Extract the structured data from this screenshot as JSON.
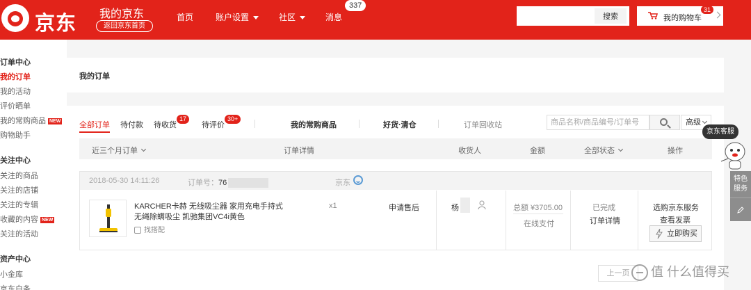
{
  "header": {
    "logo_text": "京东",
    "site_title": "我的京东",
    "home_link": "返回京东首页",
    "nav": [
      {
        "label": "首页"
      },
      {
        "label": "账户设置"
      },
      {
        "label": "社区"
      },
      {
        "label": "消息"
      }
    ],
    "message_count": "337",
    "search_value": "",
    "search_button": "搜索",
    "cart_label": "我的购物车",
    "cart_count": "31"
  },
  "sidebar": {
    "groups": [
      {
        "title": "订单中心",
        "items": [
          {
            "label": "我的订单",
            "active": true
          },
          {
            "label": "我的活动"
          },
          {
            "label": "评价晒单"
          },
          {
            "label": "我的常购商品",
            "badge": "NEW"
          },
          {
            "label": "购物助手"
          }
        ]
      },
      {
        "title": "关注中心",
        "items": [
          {
            "label": "关注的商品"
          },
          {
            "label": "关注的店铺"
          },
          {
            "label": "关注的专辑"
          },
          {
            "label": "收藏的内容",
            "badge": "NEW"
          },
          {
            "label": "关注的活动"
          }
        ]
      },
      {
        "title": "资产中心",
        "items": [
          {
            "label": "小金库"
          },
          {
            "label": "京东白条"
          }
        ]
      }
    ]
  },
  "main": {
    "page_title": "我的订单",
    "tabs": [
      {
        "label": "全部订单"
      },
      {
        "label": "待付款"
      },
      {
        "label": "待收货",
        "badge": "17"
      },
      {
        "label": "待评价",
        "badge": "30+"
      },
      {
        "label": "我的常购商品"
      },
      {
        "label": "好货·清仓"
      },
      {
        "label": "订单回收站"
      }
    ],
    "order_search_placeholder": "商品名称/商品编号/订单号",
    "advanced_label": "高级",
    "table_headers": {
      "period": "近三个月订单",
      "detail": "订单详情",
      "receiver": "收货人",
      "amount": "金额",
      "status": "全部状态",
      "ops": "操作"
    },
    "order": {
      "datetime": "2018-05-30 14:11:26",
      "order_no_label": "订单号：",
      "order_no_visible": "76",
      "shop": "京东",
      "product_name": "KARCHER卡赫 无线吸尘器 家用充电手持式无绳除螨吸尘 凯驰集团VC4i黄色",
      "match_label": "找搭配",
      "qty": "x1",
      "after_sale": "申请售后",
      "receiver": "杨",
      "amount": "总额 ¥3705.00",
      "pay_method": "在线支付",
      "status": "已完成",
      "status_detail": "订单详情",
      "op_service": "选购京东服务",
      "op_invoice": "查看发票",
      "buy_again": "立即购买"
    },
    "pager_prev": "上一页"
  },
  "float": {
    "service": "京东客服",
    "tab1": "特色\n服务"
  },
  "watermark": "值 什么值得买",
  "colors": {
    "brand_red": "#e2231a",
    "panel_gray": "#f3f3f3"
  }
}
